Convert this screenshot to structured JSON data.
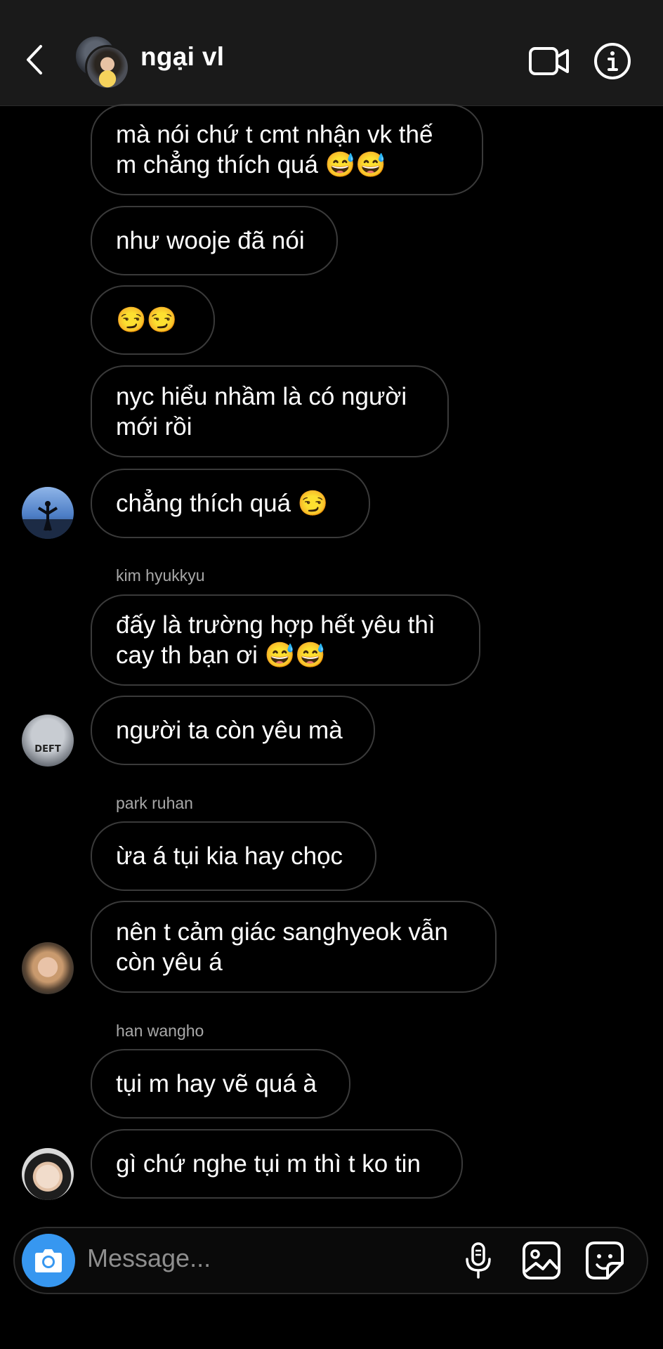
{
  "header": {
    "title": "ngại vl"
  },
  "messages": [
    {
      "text": "mà nói chứ t cmt nhận vk thế m chẳng thích quá 😅😅"
    },
    {
      "text": "như wooje đã nói"
    },
    {
      "text": "😏😏"
    },
    {
      "text": "nyc hiểu nhầm là có người mới rồi"
    },
    {
      "text": "chẳng thích quá 😏"
    },
    {
      "sender": "kim hyukkyu",
      "text": "đấy là trường hợp hết yêu thì cay th bạn ơi 😅😅"
    },
    {
      "text": "người ta còn yêu mà",
      "avatar_text": "DEFT"
    },
    {
      "sender": "park ruhan",
      "text": "ừa á tụi kia hay chọc"
    },
    {
      "text": "nên t cảm giác sanghyeok vẫn còn yêu á"
    },
    {
      "sender": "han wangho",
      "text": "tụi m hay vẽ quá à"
    },
    {
      "text": "gì chứ nghe tụi m thì t ko tin"
    }
  ],
  "composer": {
    "placeholder": "Message..."
  },
  "colors": {
    "accent": "#3797f0",
    "background": "#000000",
    "header": "#1a1a1a"
  }
}
